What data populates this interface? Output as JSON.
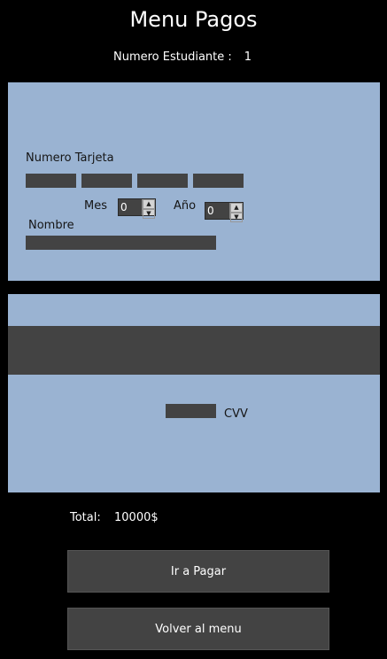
{
  "header": {
    "title": "Menu Pagos",
    "student_label": "Numero Estudiante :",
    "student_number": "1"
  },
  "card_front": {
    "card_number_label": "Numero Tarjeta",
    "card_number_fields": [
      "",
      "",
      "",
      ""
    ],
    "month_label": "Mes",
    "month_value": "0",
    "year_label": "Año",
    "year_value": "0",
    "name_label": "Nombre",
    "name_value": ""
  },
  "card_back": {
    "cvv_label": "CVV",
    "cvv_value": ""
  },
  "total": {
    "label": "Total:",
    "value": "10000$"
  },
  "buttons": {
    "pay": "Ir a Pagar",
    "back": "Volver al menu"
  },
  "colors": {
    "background": "#000000",
    "card": "#9ab3d2",
    "field": "#434343"
  }
}
